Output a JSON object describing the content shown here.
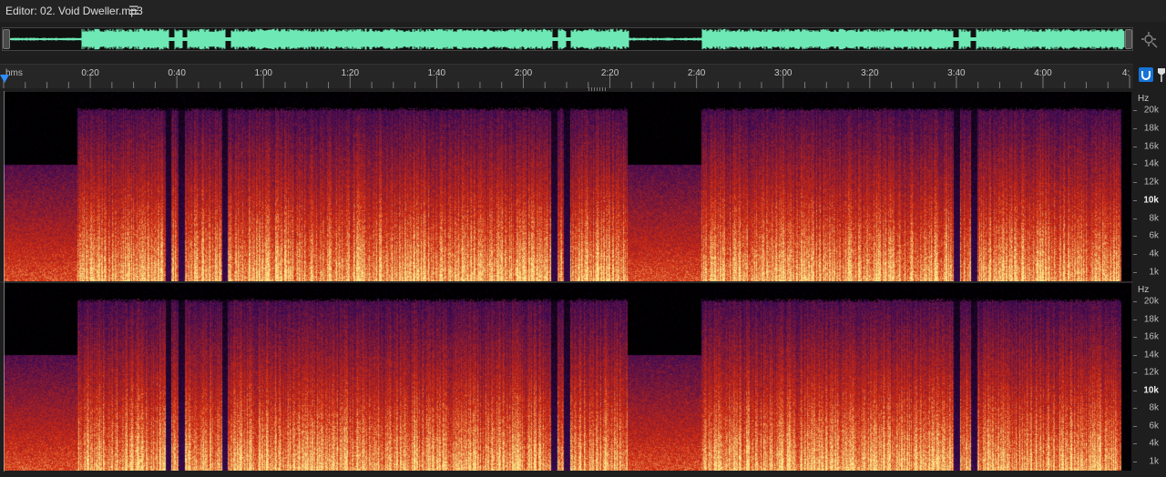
{
  "editor": {
    "title": "Editor: 02. Void Dweller.mp3",
    "menu_icon": "hamburger-icon"
  },
  "timeline": {
    "format_label": "hms",
    "tick_labels": [
      "0:20",
      "0:40",
      "1:00",
      "1:20",
      "1:40",
      "2:00",
      "2:20",
      "2:40",
      "3:00",
      "3:20",
      "3:40",
      "4:00",
      "4:"
    ]
  },
  "frequency_scale": {
    "unit": "Hz",
    "labels": [
      "20k",
      "18k",
      "16k",
      "14k",
      "12k",
      "10k",
      "8k",
      "6k",
      "4k",
      "1k"
    ]
  },
  "colors": {
    "waveform": "#6ee8b4",
    "spectro_low": "#3a0a55",
    "spectro_mid": "#d02a10",
    "spectro_high": "#ffe98a",
    "accent": "#2f8fff"
  }
}
